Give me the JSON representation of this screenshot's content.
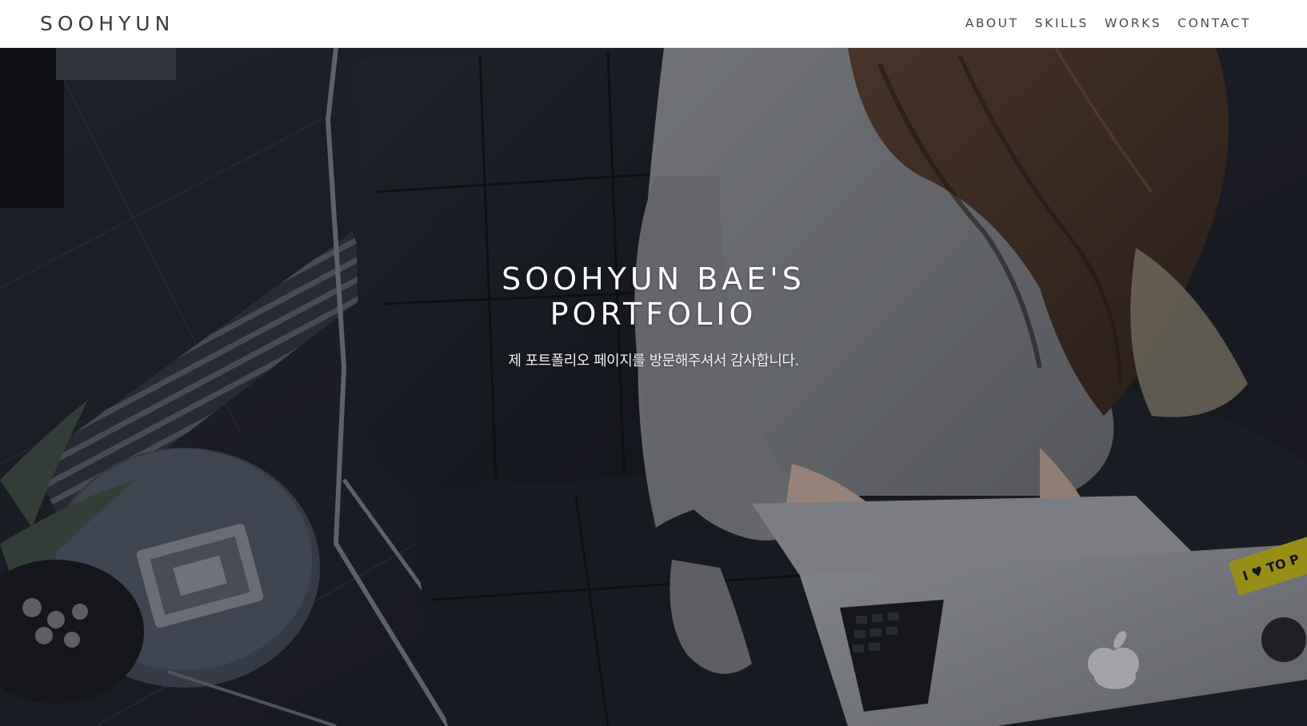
{
  "header": {
    "logo": "SOOHYUN",
    "nav": [
      {
        "label": "ABOUT"
      },
      {
        "label": "SKILLS"
      },
      {
        "label": "WORKS"
      },
      {
        "label": "CONTACT"
      }
    ]
  },
  "hero": {
    "title": "SOOHYUN BAE'S PORTFOLIO",
    "subtitle": "제 포트폴리오 페이지를 방문해주셔서 감사합니다.",
    "background_image": "woman-with-laptop-on-leather-chair",
    "laptop_sticker_text": "I ♥ TO P"
  },
  "colors": {
    "header_bg": "#ffffff",
    "header_text": "#3a3a3a",
    "hero_text": "#ffffff",
    "hero_overlay": "#0a0c14"
  }
}
